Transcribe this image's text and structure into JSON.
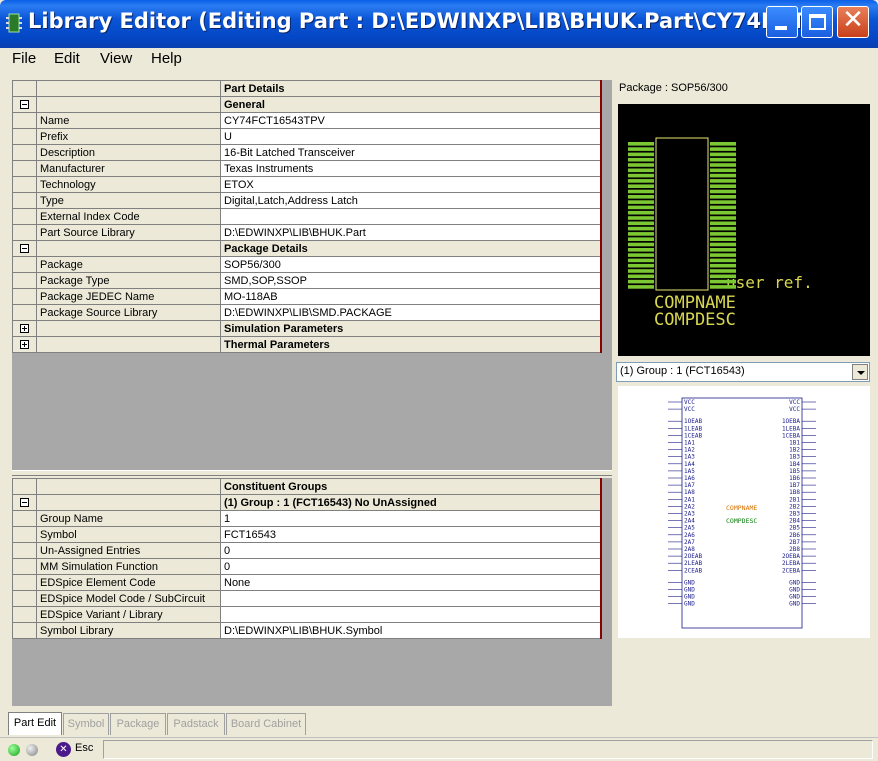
{
  "window": {
    "title": "Library Editor (Editing Part : D:\\EDWINXP\\LIB\\BHUK.Part\\CY74FCT..."
  },
  "menu": [
    "File",
    "Edit",
    "View",
    "Help"
  ],
  "part_details": {
    "header": "Part Details",
    "general": {
      "title": "General",
      "rows": [
        {
          "label": "Name",
          "value": "CY74FCT16543TPV"
        },
        {
          "label": "Prefix",
          "value": "U"
        },
        {
          "label": "Description",
          "value": "16-Bit Latched Transceiver"
        },
        {
          "label": "Manufacturer",
          "value": "Texas Instruments"
        },
        {
          "label": "Technology",
          "value": "ETOX"
        },
        {
          "label": "Type",
          "value": "Digital,Latch,Address Latch"
        },
        {
          "label": "External Index Code",
          "value": ""
        },
        {
          "label": "Part Source Library",
          "value": "D:\\EDWINXP\\LIB\\BHUK.Part"
        }
      ]
    },
    "package": {
      "title": "Package Details",
      "rows": [
        {
          "label": "Package",
          "value": "SOP56/300"
        },
        {
          "label": "Package Type",
          "value": "SMD,SOP,SSOP"
        },
        {
          "label": "Package JEDEC Name",
          "value": "MO-118AB"
        },
        {
          "label": "Package Source Library",
          "value": "D:\\EDWINXP\\LIB\\SMD.PACKAGE"
        }
      ]
    },
    "simulation": {
      "title": "Simulation Parameters"
    },
    "thermal": {
      "title": "Thermal Parameters"
    }
  },
  "constituent_groups": {
    "header": "Constituent Groups",
    "group_title": "(1) Group : 1 (FCT16543) No UnAssigned",
    "rows": [
      {
        "label": "Group Name",
        "value": "1"
      },
      {
        "label": "Symbol",
        "value": "FCT16543"
      },
      {
        "label": "Un-Assigned Entries",
        "value": "0"
      },
      {
        "label": "MM Simulation Function",
        "value": " 0"
      },
      {
        "label": "EDSpice Element Code",
        "value": "None"
      },
      {
        "label": "EDSpice Model Code / SubCircuit",
        "value": ""
      },
      {
        "label": "EDSpice Variant / Library",
        "value": ""
      },
      {
        "label": "Symbol Library",
        "value": "D:\\EDWINXP\\LIB\\BHUK.Symbol"
      }
    ]
  },
  "package_preview": {
    "label": "Package : SOP56/300",
    "texts": {
      "user_ref": "user ref.",
      "compname": "COMPNAME",
      "compdesc": "COMPDESC"
    },
    "colors": {
      "background": "#000000",
      "pad": "#7cc832",
      "outline": "#e8e870",
      "label": "#d8d850"
    }
  },
  "group_select": {
    "value": "(1) Group : 1 (FCT16543)"
  },
  "symbol_preview": {
    "texts": {
      "compname": "COMPNAME",
      "compdesc": "COMPDESC"
    },
    "left_pins": [
      "VCC",
      "VCC",
      "1OEAB",
      "1LEAB",
      "1CEAB",
      "1A1",
      "1A2",
      "1A3",
      "1A4",
      "1A5",
      "1A6",
      "1A7",
      "1A8",
      "2A1",
      "2A2",
      "2A3",
      "2A4",
      "2A5",
      "2A6",
      "2A7",
      "2A8",
      "2OEAB",
      "2LEAB",
      "2CEAB",
      "GND",
      "GND",
      "GND",
      "GND"
    ],
    "right_pins": [
      "VCC",
      "VCC",
      "1OEBA",
      "1LEBA",
      "1CEBA",
      "1B1",
      "1B2",
      "1B3",
      "1B4",
      "1B5",
      "1B6",
      "1B7",
      "1B8",
      "2B1",
      "2B2",
      "2B3",
      "2B4",
      "2B5",
      "2B6",
      "2B7",
      "2B8",
      "2OEBA",
      "2LEBA",
      "2CEBA",
      "GND",
      "GND",
      "GND",
      "GND"
    ],
    "colors": {
      "pin": "#1a1a8a",
      "compname": "#d87000",
      "compdesc": "#108010"
    }
  },
  "tabs": [
    {
      "label": "Part Edit",
      "active": true
    },
    {
      "label": "Symbol",
      "active": false
    },
    {
      "label": "Package",
      "active": false
    },
    {
      "label": "Padstack",
      "active": false
    },
    {
      "label": "Board Cabinet",
      "active": false
    }
  ],
  "status": {
    "esc_label": "Esc"
  }
}
